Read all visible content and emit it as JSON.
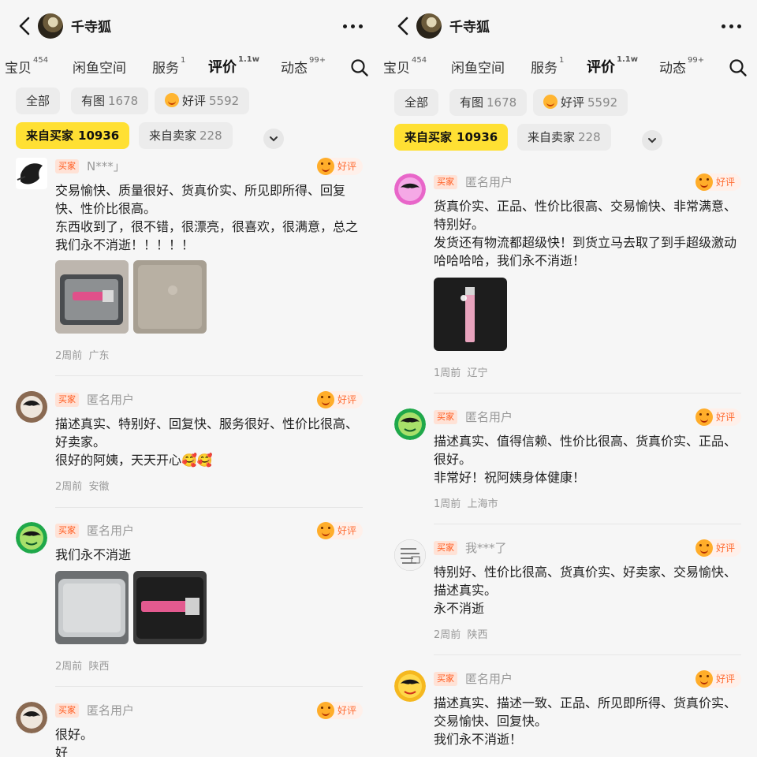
{
  "panels": [
    {
      "header": {
        "shop_name": "千寺狐"
      },
      "tabs": [
        {
          "label": "宝贝",
          "count": "454"
        },
        {
          "label": "闲鱼空间",
          "count": ""
        },
        {
          "label": "服务",
          "count": "1"
        },
        {
          "label": "评价",
          "count": "1.1w"
        },
        {
          "label": "动态",
          "count": "99+"
        }
      ],
      "chips": [
        {
          "label": "全部",
          "count": ""
        },
        {
          "label": "有图",
          "count": "1678"
        },
        {
          "label": "好评",
          "count": "5592"
        }
      ],
      "source": [
        {
          "label": "来自买家",
          "count": "10936"
        },
        {
          "label": "来自卖家",
          "count": "228"
        }
      ],
      "reviews": [
        {
          "role": "买家",
          "user": "N***」",
          "rating": "好评",
          "lines": [
            "交易愉快、质量很好、货真价实、所见即所得、回复快、性价比很高。",
            "东西收到了，很不错，很漂亮，很喜欢，很满意，总之我们永不消逝！！！！！"
          ],
          "time": "2周前",
          "location": "广东"
        },
        {
          "role": "买家",
          "user": "匿名用户",
          "rating": "好评",
          "lines": [
            "描述真实、特别好、回复快、服务很好、性价比很高、好卖家。",
            "很好的阿姨，天天开心🥰🥰"
          ],
          "time": "2周前",
          "location": "安徽"
        },
        {
          "role": "买家",
          "user": "匿名用户",
          "rating": "好评",
          "lines": [
            "我们永不消逝"
          ],
          "time": "2周前",
          "location": "陕西"
        },
        {
          "role": "买家",
          "user": "匿名用户",
          "rating": "好评",
          "lines": [
            "很好。",
            "好"
          ],
          "time": "",
          "location": ""
        }
      ]
    },
    {
      "header": {
        "shop_name": "千寺狐"
      },
      "tabs": [
        {
          "label": "宝贝",
          "count": "454"
        },
        {
          "label": "闲鱼空间",
          "count": ""
        },
        {
          "label": "服务",
          "count": "1"
        },
        {
          "label": "评价",
          "count": "1.1w"
        },
        {
          "label": "动态",
          "count": "99+"
        }
      ],
      "chips": [
        {
          "label": "全部",
          "count": ""
        },
        {
          "label": "有图",
          "count": "1678"
        },
        {
          "label": "好评",
          "count": "5592"
        }
      ],
      "source": [
        {
          "label": "来自买家",
          "count": "10936"
        },
        {
          "label": "来自卖家",
          "count": "228"
        }
      ],
      "reviews": [
        {
          "role": "买家",
          "user": "匿名用户",
          "rating": "好评",
          "lines": [
            "货真价实、正品、性价比很高、交易愉快、非常满意、特别好。",
            "发货还有物流都超级快！到货立马去取了到手超级激动哈哈哈哈，我们永不消逝！"
          ],
          "time": "1周前",
          "location": "辽宁"
        },
        {
          "role": "买家",
          "user": "匿名用户",
          "rating": "好评",
          "lines": [
            "描述真实、值得信赖、性价比很高、货真价实、正品、很好。",
            "非常好！祝阿姨身体健康！"
          ],
          "time": "1周前",
          "location": "上海市"
        },
        {
          "role": "买家",
          "user": "我***了",
          "rating": "好评",
          "lines": [
            "特别好、性价比很高、货真价实、好卖家、交易愉快、描述真实。",
            "永不消逝"
          ],
          "time": "2周前",
          "location": "陕西"
        },
        {
          "role": "买家",
          "user": "匿名用户",
          "rating": "好评",
          "lines": [
            "描述真实、描述一致、正品、所见即所得、货真价实、交易愉快、回复快。",
            "我们永不消逝！"
          ],
          "time": "",
          "location": ""
        }
      ]
    }
  ],
  "colors": {
    "accent_yellow": "#ffe033",
    "badge_orange": "#ff5b1f",
    "good_orange": "#ff6d33"
  }
}
